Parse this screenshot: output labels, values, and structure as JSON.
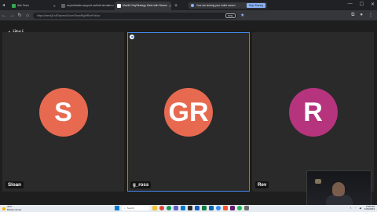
{
  "browser": {
    "tabs": [
      {
        "label": "Alto Team",
        "favicon_color": "#34a853",
        "active": false
      },
      {
        "label": "sa.pinkbanks.support.ca/hold.sinclaire.co...",
        "favicon_color": "#5f6368",
        "active": false
      },
      {
        "label": "MeetIt.OnlyStrategy Meet with Sloane",
        "favicon_color": "#ffffff",
        "active": true
      }
    ],
    "new_tab": "+",
    "share_notice": "Your are sharing your entire screen",
    "stop_sharing": "Stop Sharing",
    "url": "https://meet.jit.si/ExpressScrumTeamRightRiveFollow",
    "omnibox_badge": "Write"
  },
  "meeting": {
    "logo": "jitsi",
    "participants": [
      {
        "initials": "S",
        "name": "Sloan",
        "avatar_color": "#e76a50"
      },
      {
        "initials": "GR",
        "name": "g_ross",
        "avatar_color": "#e76a50"
      },
      {
        "initials": "R",
        "name": "Rev",
        "avatar_color": "#b5347d"
      }
    ]
  },
  "taskbar": {
    "weather_temp": "43°F",
    "weather_desc": "Mostly cloudy",
    "search_placeholder": "Search",
    "time": "9:28 AM",
    "date": "1/26/2023"
  },
  "icons": {
    "back": "arrow-left-icon",
    "forward": "arrow-right-icon",
    "reload": "reload-icon",
    "home": "home-icon",
    "star": "star-icon",
    "extensions": "puzzle-icon",
    "profile": "profile-icon",
    "menu": "kebab-menu-icon"
  }
}
